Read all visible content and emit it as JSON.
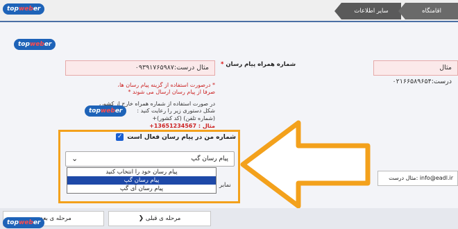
{
  "header": {
    "tab_active": "سایر اطلاعات",
    "tab_inactive": "اقامتگاه"
  },
  "brand": {
    "logo_main": "topweber",
    "logo_accent": "web"
  },
  "form": {
    "courier_label": "شماره همراه پیام رسان",
    "courier_placeholder": "مثال درست:۰۹۳۹۱۷۶۵۹۸۷",
    "phone_placeholder": "مثال درست:۰۲۱۶۶۵۸۹۶۵۴",
    "hint_red_1": "* درصورت استفاده از گزینه پیام رسان ها،",
    "hint_red_2": "صرفا از پیام رسان ارسال می شوند *",
    "hint_dark_1": "در صورت استفاده از شماره همراه خارج از کشور،",
    "hint_dark_2": "شکل دستوری زیر را رعایت کنید :",
    "hint_dark_3": "(شماره تلفن) (کد کشور)+",
    "hint_dark_4": "مثال : 13651234567+",
    "checkbox_label": "شماره من در پیام رسان فعال است",
    "checkbox_mark": "✓",
    "select_value": "پیام رسان گپ",
    "options": [
      "پیام رسان خود را انتخاب کنید",
      "پیام رسان گپ",
      "پیام رسان آی گپ"
    ],
    "selected_index": 1,
    "side_label": "نمابر",
    "email_value": "info@eadl.ir :مثال درست"
  },
  "buttons": {
    "prev_label": "مرحله ی قبلی",
    "next_label": "مرحله ی بعدی",
    "prev_icon": "chevron-right-icon",
    "next_icon": "chevron-left-icon"
  },
  "colors": {
    "highlight": "#f3a11c",
    "selected_option": "#1e49a8",
    "error_field": "#fbe9ea"
  }
}
